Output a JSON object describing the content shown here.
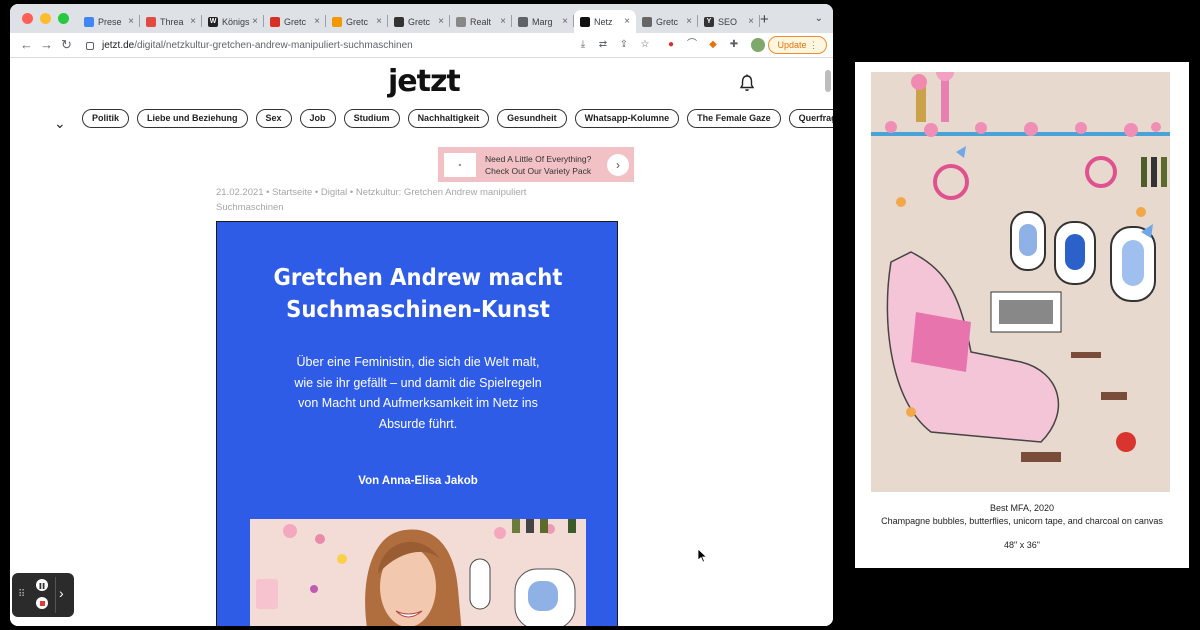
{
  "browser": {
    "tabs": [
      {
        "title": "Prese",
        "color": "#4285f4",
        "glyph": ""
      },
      {
        "title": "Threa",
        "color": "#e04a3f",
        "glyph": ""
      },
      {
        "title": "Königs",
        "color": "#222222",
        "glyph": "W"
      },
      {
        "title": "Gretc",
        "color": "#d93025",
        "glyph": ""
      },
      {
        "title": "Gretc",
        "color": "#f29900",
        "glyph": ""
      },
      {
        "title": "Gretc",
        "color": "#333333",
        "glyph": ""
      },
      {
        "title": "Realt",
        "color": "#888888",
        "glyph": ""
      },
      {
        "title": "Marg",
        "color": "#5f6368",
        "glyph": ""
      },
      {
        "title": "Netz",
        "color": "#111111",
        "glyph": ""
      },
      {
        "title": "Gretc",
        "color": "#666666",
        "glyph": ""
      },
      {
        "title": "SEO",
        "color": "#333333",
        "glyph": "Y"
      }
    ],
    "active_tab_index": 8,
    "url_host": "jetzt.de",
    "url_path": "/digital/netzkultur-gretchen-andrew-manipuliert-suchmaschinen",
    "update_label": "Update"
  },
  "site": {
    "logo": "jetzt",
    "categories": [
      "Politik",
      "Liebe und Beziehung",
      "Sex",
      "Job",
      "Studium",
      "Nachhaltigkeit",
      "Gesundheit",
      "Whatsapp-Kolumne",
      "The Female Gaze",
      "Querfragen"
    ]
  },
  "ad": {
    "line1": "Need A Little Of Everything?",
    "line2": "Check Out Our Variety Pack"
  },
  "article": {
    "breadcrumb": "21.02.2021 • Startseite • Digital • Netzkultur: Gretchen Andrew manipuliert Suchmaschinen",
    "title_line1": "Gretchen Andrew macht",
    "title_line2": "Suchmaschinen-Kunst",
    "lead": "Über eine Feministin, die sich die Welt malt, wie sie ihr gefällt – und damit die Spielregeln von Macht und Aufmerksamkeit im Netz ins Absurde führt.",
    "author": "Von Anna-Elisa Jakob",
    "hero_bg": "#2f5ce6"
  },
  "artwork": {
    "caption_title": "Best MFA, 2020",
    "caption_medium": "Champagne bubbles, butterflies, unicorn tape, and charcoal on canvas",
    "caption_size": "48\" x 36\""
  }
}
